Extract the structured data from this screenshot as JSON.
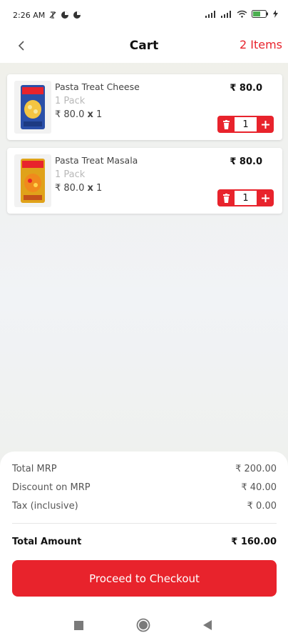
{
  "status_bar": {
    "time": "2:26 AM",
    "icons_left": [
      "mute-icon",
      "data-saver-icon",
      "data-saver-icon"
    ],
    "icons_right": [
      "signal-icon",
      "signal-icon",
      "wifi-icon",
      "battery-icon",
      "charging-icon"
    ]
  },
  "header": {
    "title": "Cart",
    "item_count": "2 Items",
    "back_icon": "chevron-left-icon"
  },
  "cart": {
    "items": [
      {
        "name": "Pasta Treat Cheese",
        "pack": "1 Pack",
        "unit_price": "₹ 80.0",
        "mult": "x",
        "unit_qty": "1",
        "total": "₹ 80.0",
        "qty": "1",
        "thumb_color": "#2a4fa8"
      },
      {
        "name": "Pasta Treat Masala",
        "pack": "1 Pack",
        "unit_price": "₹ 80.0",
        "mult": "x",
        "unit_qty": "1",
        "total": "₹ 80.0",
        "qty": "1",
        "thumb_color": "#e0a21a"
      }
    ]
  },
  "summary": {
    "rows": [
      {
        "label": "Total MRP",
        "value": "₹ 200.00"
      },
      {
        "label": "Discount on MRP",
        "value": "₹ 40.00"
      },
      {
        "label": "Tax (inclusive)",
        "value": "₹ 0.00"
      }
    ],
    "total_label": "Total Amount",
    "total_value": "₹ 160.00",
    "checkout_label": "Proceed to Checkout"
  },
  "nav": {
    "icons": [
      "recents-square-icon",
      "home-circle-icon",
      "back-triangle-icon"
    ]
  },
  "colors": {
    "accent": "#e8232c",
    "text": "#222222",
    "muted": "#b8b8b8"
  }
}
